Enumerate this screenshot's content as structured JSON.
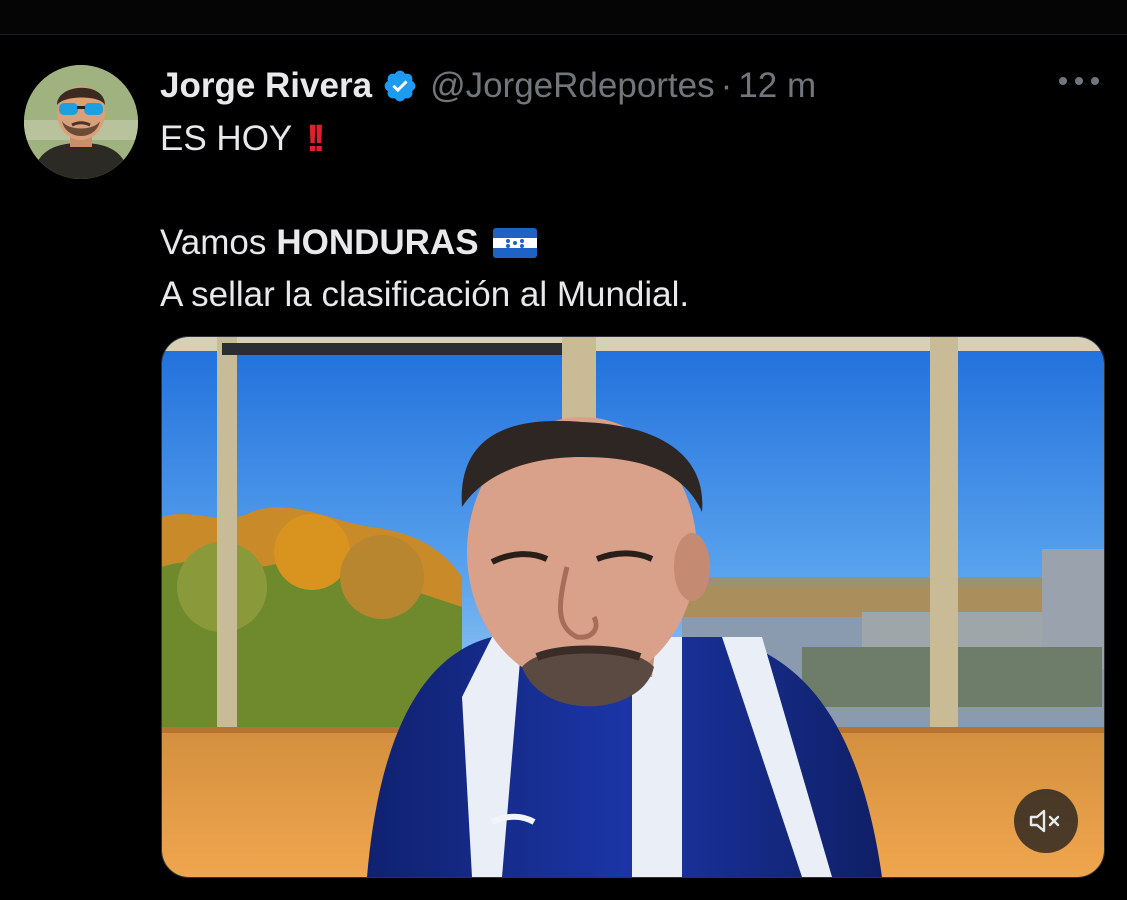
{
  "tweet": {
    "author_name": "Jorge Rivera",
    "handle": "@JorgeRdeportes",
    "separator": "·",
    "time": "12 m",
    "line1": "ES HOY",
    "line1_emoji": "!!",
    "line2_prefix": "Vamos",
    "line2_bold": "HONDURAS",
    "line3": "A sellar la clasificación al Mundial."
  },
  "icons": {
    "verified": "verified-badge-icon",
    "more": "more-options-icon",
    "mute": "muted-speaker-icon",
    "flag": "honduras-flag-icon"
  },
  "colors": {
    "background": "#000000",
    "text_primary": "#e7e9ea",
    "text_secondary": "#71767b",
    "verified_blue": "#1d9bf0",
    "emoji_red": "#e0202f"
  },
  "media": {
    "type": "video",
    "muted": true
  }
}
